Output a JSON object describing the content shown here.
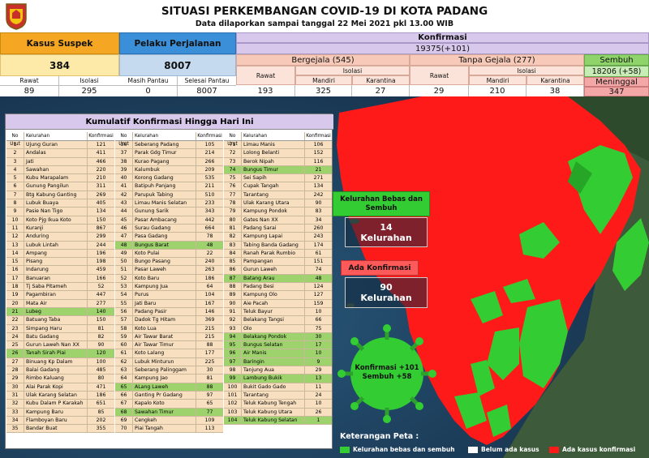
{
  "header": {
    "title": "SITUASI PERKEMBANGAN COVID-19 DI KOTA PADANG",
    "subtitle": "Data dilaporkan sampai tanggal 22 Mei 2021 pkl 13.00 WIB",
    "logo_icon": "padang-city-emblem-icon"
  },
  "stats": {
    "suspek": {
      "label": "Kasus Suspek",
      "total": "384",
      "rawat_label": "Rawat",
      "isolasi_label": "Isolasi",
      "rawat": "89",
      "isolasi": "295"
    },
    "perjalanan": {
      "label": "Pelaku Perjalanan",
      "total": "8007",
      "pantau_label": "Masih Pantau",
      "selesai_label": "Selesai Pantau",
      "pantau": "0",
      "selesai": "8007"
    },
    "konfirmasi": {
      "label": "Konfirmasi",
      "total": "19375(+101)"
    },
    "bergejala": {
      "label": "Bergejala (545)",
      "rawat_label": "Rawat",
      "isolasi_label": "Isolasi",
      "mandiri_label": "Mandiri",
      "karantina_label": "Karantina",
      "rawat": "193",
      "mandiri": "325",
      "karantina": "27"
    },
    "tanpa_gejala": {
      "label": "Tanpa Gejala (277)",
      "rawat_label": "Rawat",
      "isolasi_label": "Isolasi",
      "mandiri_label": "Mandiri",
      "karantina_label": "Karantina",
      "rawat": "29",
      "mandiri": "210",
      "karantina": "38"
    },
    "sembuh": {
      "label": "Sembuh",
      "value": "18206 (+58)"
    },
    "meninggal": {
      "label": "Meninggal",
      "value": "347"
    }
  },
  "table": {
    "title": "Kumulatif Konfirmasi Hingga Hari Ini",
    "col_no": "No Urut",
    "col_kel": "Kelurahan",
    "col_konf": "Konfirmasi",
    "columns": [
      [
        [
          "1",
          "Ujung Guran",
          "121",
          false
        ],
        [
          "2",
          "Andalas",
          "411",
          false
        ],
        [
          "3",
          "Jati",
          "466",
          false
        ],
        [
          "4",
          "Sawahan",
          "220",
          false
        ],
        [
          "5",
          "Kubu Marapalam",
          "210",
          false
        ],
        [
          "6",
          "Gunung Pangilun",
          "311",
          false
        ],
        [
          "7",
          "Btg Kabung Ganting",
          "269",
          false
        ],
        [
          "8",
          "Lubuk Buaya",
          "405",
          false
        ],
        [
          "9",
          "Pasie Nan Tigo",
          "134",
          false
        ],
        [
          "10",
          "Koto Pjg Ikua Koto",
          "150",
          false
        ],
        [
          "11",
          "Kuranji",
          "867",
          false
        ],
        [
          "12",
          "Anduring",
          "299",
          false
        ],
        [
          "13",
          "Lubuk Lintah",
          "244",
          false
        ],
        [
          "14",
          "Ampang",
          "196",
          false
        ],
        [
          "15",
          "Pisang",
          "198",
          false
        ],
        [
          "16",
          "Indarung",
          "459",
          false
        ],
        [
          "17",
          "Banuaran",
          "166",
          false
        ],
        [
          "18",
          "Tj Saba Pitameh",
          "52",
          false
        ],
        [
          "19",
          "Pagambiran",
          "447",
          false
        ],
        [
          "20",
          "Mata Air",
          "277",
          false
        ],
        [
          "21",
          "Lubeg",
          "140",
          true
        ],
        [
          "22",
          "Batuang Taba",
          "150",
          false
        ],
        [
          "23",
          "Simpang Haru",
          "81",
          false
        ],
        [
          "24",
          "Batu Gadang",
          "82",
          false
        ],
        [
          "25",
          "Gurun Laweh Nan XX",
          "90",
          false
        ],
        [
          "26",
          "Tanah Sirah Piai",
          "120",
          true
        ],
        [
          "27",
          "Binuang Kp Dalam",
          "100",
          false
        ],
        [
          "28",
          "Balai Gadang",
          "485",
          false
        ],
        [
          "29",
          "Rimbo Kaluang",
          "80",
          false
        ],
        [
          "30",
          "Alai Parak Kopi",
          "471",
          false
        ],
        [
          "31",
          "Ulak Karang Selatan",
          "186",
          false
        ],
        [
          "32",
          "Kubu Dalam P Karakah",
          "651",
          false
        ],
        [
          "33",
          "Kampung Baru",
          "85",
          false
        ],
        [
          "34",
          "Flamboyan Baru",
          "202",
          false
        ],
        [
          "35",
          "Bandar Buat",
          "355",
          false
        ]
      ],
      [
        [
          "36",
          "Seberang Padang",
          "105",
          false
        ],
        [
          "37",
          "Parak Gdg Timur",
          "214",
          false
        ],
        [
          "38",
          "Kurao Pagang",
          "266",
          false
        ],
        [
          "39",
          "Kalumbuk",
          "209",
          false
        ],
        [
          "40",
          "Korong Gadang",
          "535",
          false
        ],
        [
          "41",
          "Batipuh Panjang",
          "211",
          false
        ],
        [
          "42",
          "Parupuk Tabing",
          "510",
          false
        ],
        [
          "43",
          "Limau Manis Selatan",
          "233",
          false
        ],
        [
          "44",
          "Gunung Sarik",
          "343",
          false
        ],
        [
          "45",
          "Pasar Ambacang",
          "442",
          false
        ],
        [
          "46",
          "Surau Gadang",
          "664",
          false
        ],
        [
          "47",
          "Pasa Gadang",
          "78",
          false
        ],
        [
          "48",
          "Bungus Barat",
          "48",
          true
        ],
        [
          "49",
          "Koto Pulai",
          "22",
          false
        ],
        [
          "50",
          "Bungo Pasang",
          "240",
          false
        ],
        [
          "51",
          "Pasar Laweh",
          "263",
          false
        ],
        [
          "52",
          "Koto Baru",
          "186",
          false
        ],
        [
          "53",
          "Kampung Jua",
          "64",
          false
        ],
        [
          "54",
          "Purus",
          "104",
          false
        ],
        [
          "55",
          "Jati Baru",
          "167",
          false
        ],
        [
          "56",
          "Padang Pasir",
          "146",
          false
        ],
        [
          "57",
          "Dadok Tg Hitam",
          "369",
          false
        ],
        [
          "58",
          "Koto Lua",
          "215",
          false
        ],
        [
          "59",
          "Air Tawar Barat",
          "215",
          false
        ],
        [
          "60",
          "Air Tawar Timur",
          "88",
          false
        ],
        [
          "61",
          "Koto Lalang",
          "177",
          false
        ],
        [
          "62",
          "Lubuk Minturun",
          "225",
          false
        ],
        [
          "63",
          "Seberang Palinggam",
          "30",
          false
        ],
        [
          "64",
          "Kampung Jao",
          "81",
          false
        ],
        [
          "65",
          "ALang Laweh",
          "88",
          true
        ],
        [
          "66",
          "Ganting Pr Gadang",
          "97",
          false
        ],
        [
          "67",
          "Kapalo Koto",
          "65",
          false
        ],
        [
          "68",
          "Sawahan Timur",
          "77",
          true
        ],
        [
          "69",
          "Cengkeh",
          "109",
          false
        ],
        [
          "70",
          "Piai Tangah",
          "113",
          false
        ]
      ],
      [
        [
          "71",
          "Limau Manis",
          "106",
          false
        ],
        [
          "72",
          "Lolong Belanti",
          "152",
          false
        ],
        [
          "73",
          "Berok Nipah",
          "116",
          false
        ],
        [
          "74",
          "Bungus Timur",
          "21",
          true
        ],
        [
          "75",
          "Sei Sapih",
          "271",
          false
        ],
        [
          "76",
          "Cupak Tangah",
          "134",
          false
        ],
        [
          "77",
          "Tarantang",
          "242",
          false
        ],
        [
          "78",
          "Ulak Karang Utara",
          "90",
          false
        ],
        [
          "79",
          "Kampung Pondok",
          "83",
          false
        ],
        [
          "80",
          "Gates Nan XX",
          "34",
          false
        ],
        [
          "81",
          "Padang Sarai",
          "260",
          false
        ],
        [
          "82",
          "Kampung Lapai",
          "243",
          false
        ],
        [
          "83",
          "Tabing Banda Gadang",
          "174",
          false
        ],
        [
          "84",
          "Ranah Parak Rumbio",
          "61",
          false
        ],
        [
          "85",
          "Pampangan",
          "151",
          false
        ],
        [
          "86",
          "Gurun Laweh",
          "74",
          false
        ],
        [
          "87",
          "Batang Arau",
          "48",
          true
        ],
        [
          "88",
          "Padang Besi",
          "124",
          false
        ],
        [
          "89",
          "Kampung Olo",
          "127",
          false
        ],
        [
          "90",
          "Aie Pacah",
          "159",
          false
        ],
        [
          "91",
          "Teluk Bayur",
          "10",
          false
        ],
        [
          "92",
          "Belakang Tangsi",
          "66",
          false
        ],
        [
          "93",
          "Olo",
          "75",
          false
        ],
        [
          "94",
          "Belakang Pondok",
          "30",
          true
        ],
        [
          "95",
          "Bungus Selatan",
          "17",
          true
        ],
        [
          "96",
          "Air Manis",
          "10",
          true
        ],
        [
          "97",
          "Baringin",
          "9",
          true
        ],
        [
          "98",
          "Tanjung Aua",
          "29",
          false
        ],
        [
          "99",
          "Lambung Bukik",
          "13",
          true
        ],
        [
          "100",
          "Bukit Gado Gado",
          "11",
          false
        ],
        [
          "101",
          "Tarantang",
          "24",
          false
        ],
        [
          "102",
          "Teluk Kabung Tengah",
          "10",
          false
        ],
        [
          "103",
          "Teluk Kabung Utara",
          "26",
          false
        ],
        [
          "104",
          "Teluk Kabung Selatan",
          "1",
          true
        ]
      ]
    ]
  },
  "panels": {
    "bebas_label": "Kelurahan Bebas dan Sembuh",
    "bebas_count": "14",
    "bebas_unit": "Kelurahan",
    "ada_label": "Ada Konfirmasi",
    "ada_count": "90",
    "ada_unit": "Kelurahan",
    "virus_line1": "Konfirmasi +101",
    "virus_line2": "Sembuh +58"
  },
  "legend": {
    "title": "Keterangan Peta :",
    "items": [
      {
        "label": "Kelurahan bebas dan sembuh",
        "color": "#33cc33"
      },
      {
        "label": "Belum ada kasus",
        "color": "#ffffff"
      },
      {
        "label": "Ada kasus konfirmasi",
        "color": "#ff1a1a"
      }
    ]
  },
  "colors": {
    "suspek": "#f5a623",
    "suspek_light": "#fde9a8",
    "perjalanan": "#3b8fd9",
    "perjalanan_light": "#c5d9ef",
    "konfirmasi": "#d7c8ec",
    "bergejala": "#f6c9b8",
    "sembuh": "#8fd46a",
    "meninggal": "#f4a7a7",
    "map_red": "#ff1a1a",
    "map_green": "#33cc33"
  }
}
